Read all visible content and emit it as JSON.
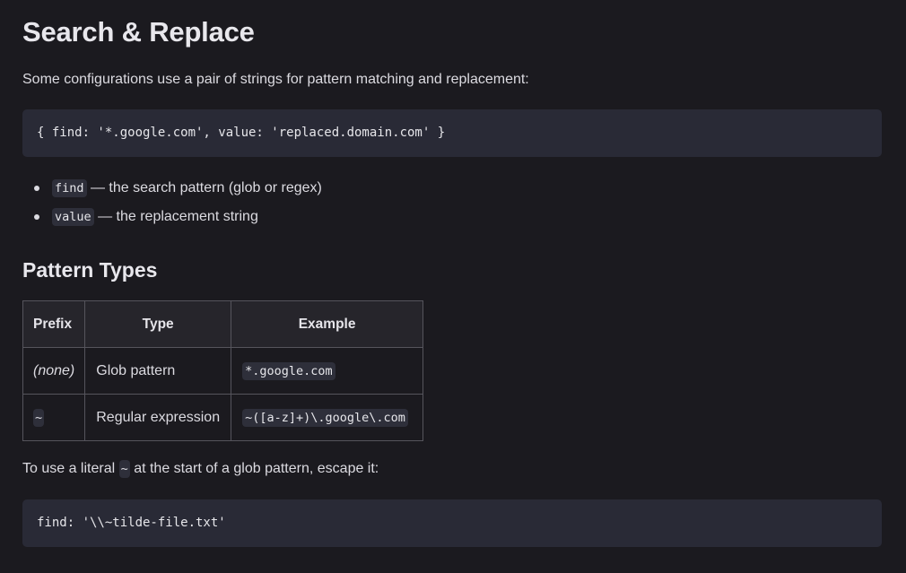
{
  "heading": "Search & Replace",
  "intro": "Some configurations use a pair of strings for pattern matching and replacement:",
  "code_example": "{ find: '*.google.com', value: 'replaced.domain.com' }",
  "list": [
    {
      "code": "find",
      "text": " — the search pattern (glob or regex)"
    },
    {
      "code": "value",
      "text": " — the replacement string"
    }
  ],
  "subheading": "Pattern Types",
  "table": {
    "headers": [
      "Prefix",
      "Type",
      "Example"
    ],
    "rows": [
      {
        "prefix": "(none)",
        "type": "Glob pattern",
        "example": "*.google.com"
      },
      {
        "prefix": "~",
        "type": "Regular expression",
        "example": "~([a-z]+)\\.google\\.com"
      }
    ]
  },
  "escape_note": {
    "before": "To use a literal ",
    "code": "~",
    "after": " at the start of a glob pattern, escape it:"
  },
  "escape_code": "find: '\\\\~tilde-file.txt'"
}
